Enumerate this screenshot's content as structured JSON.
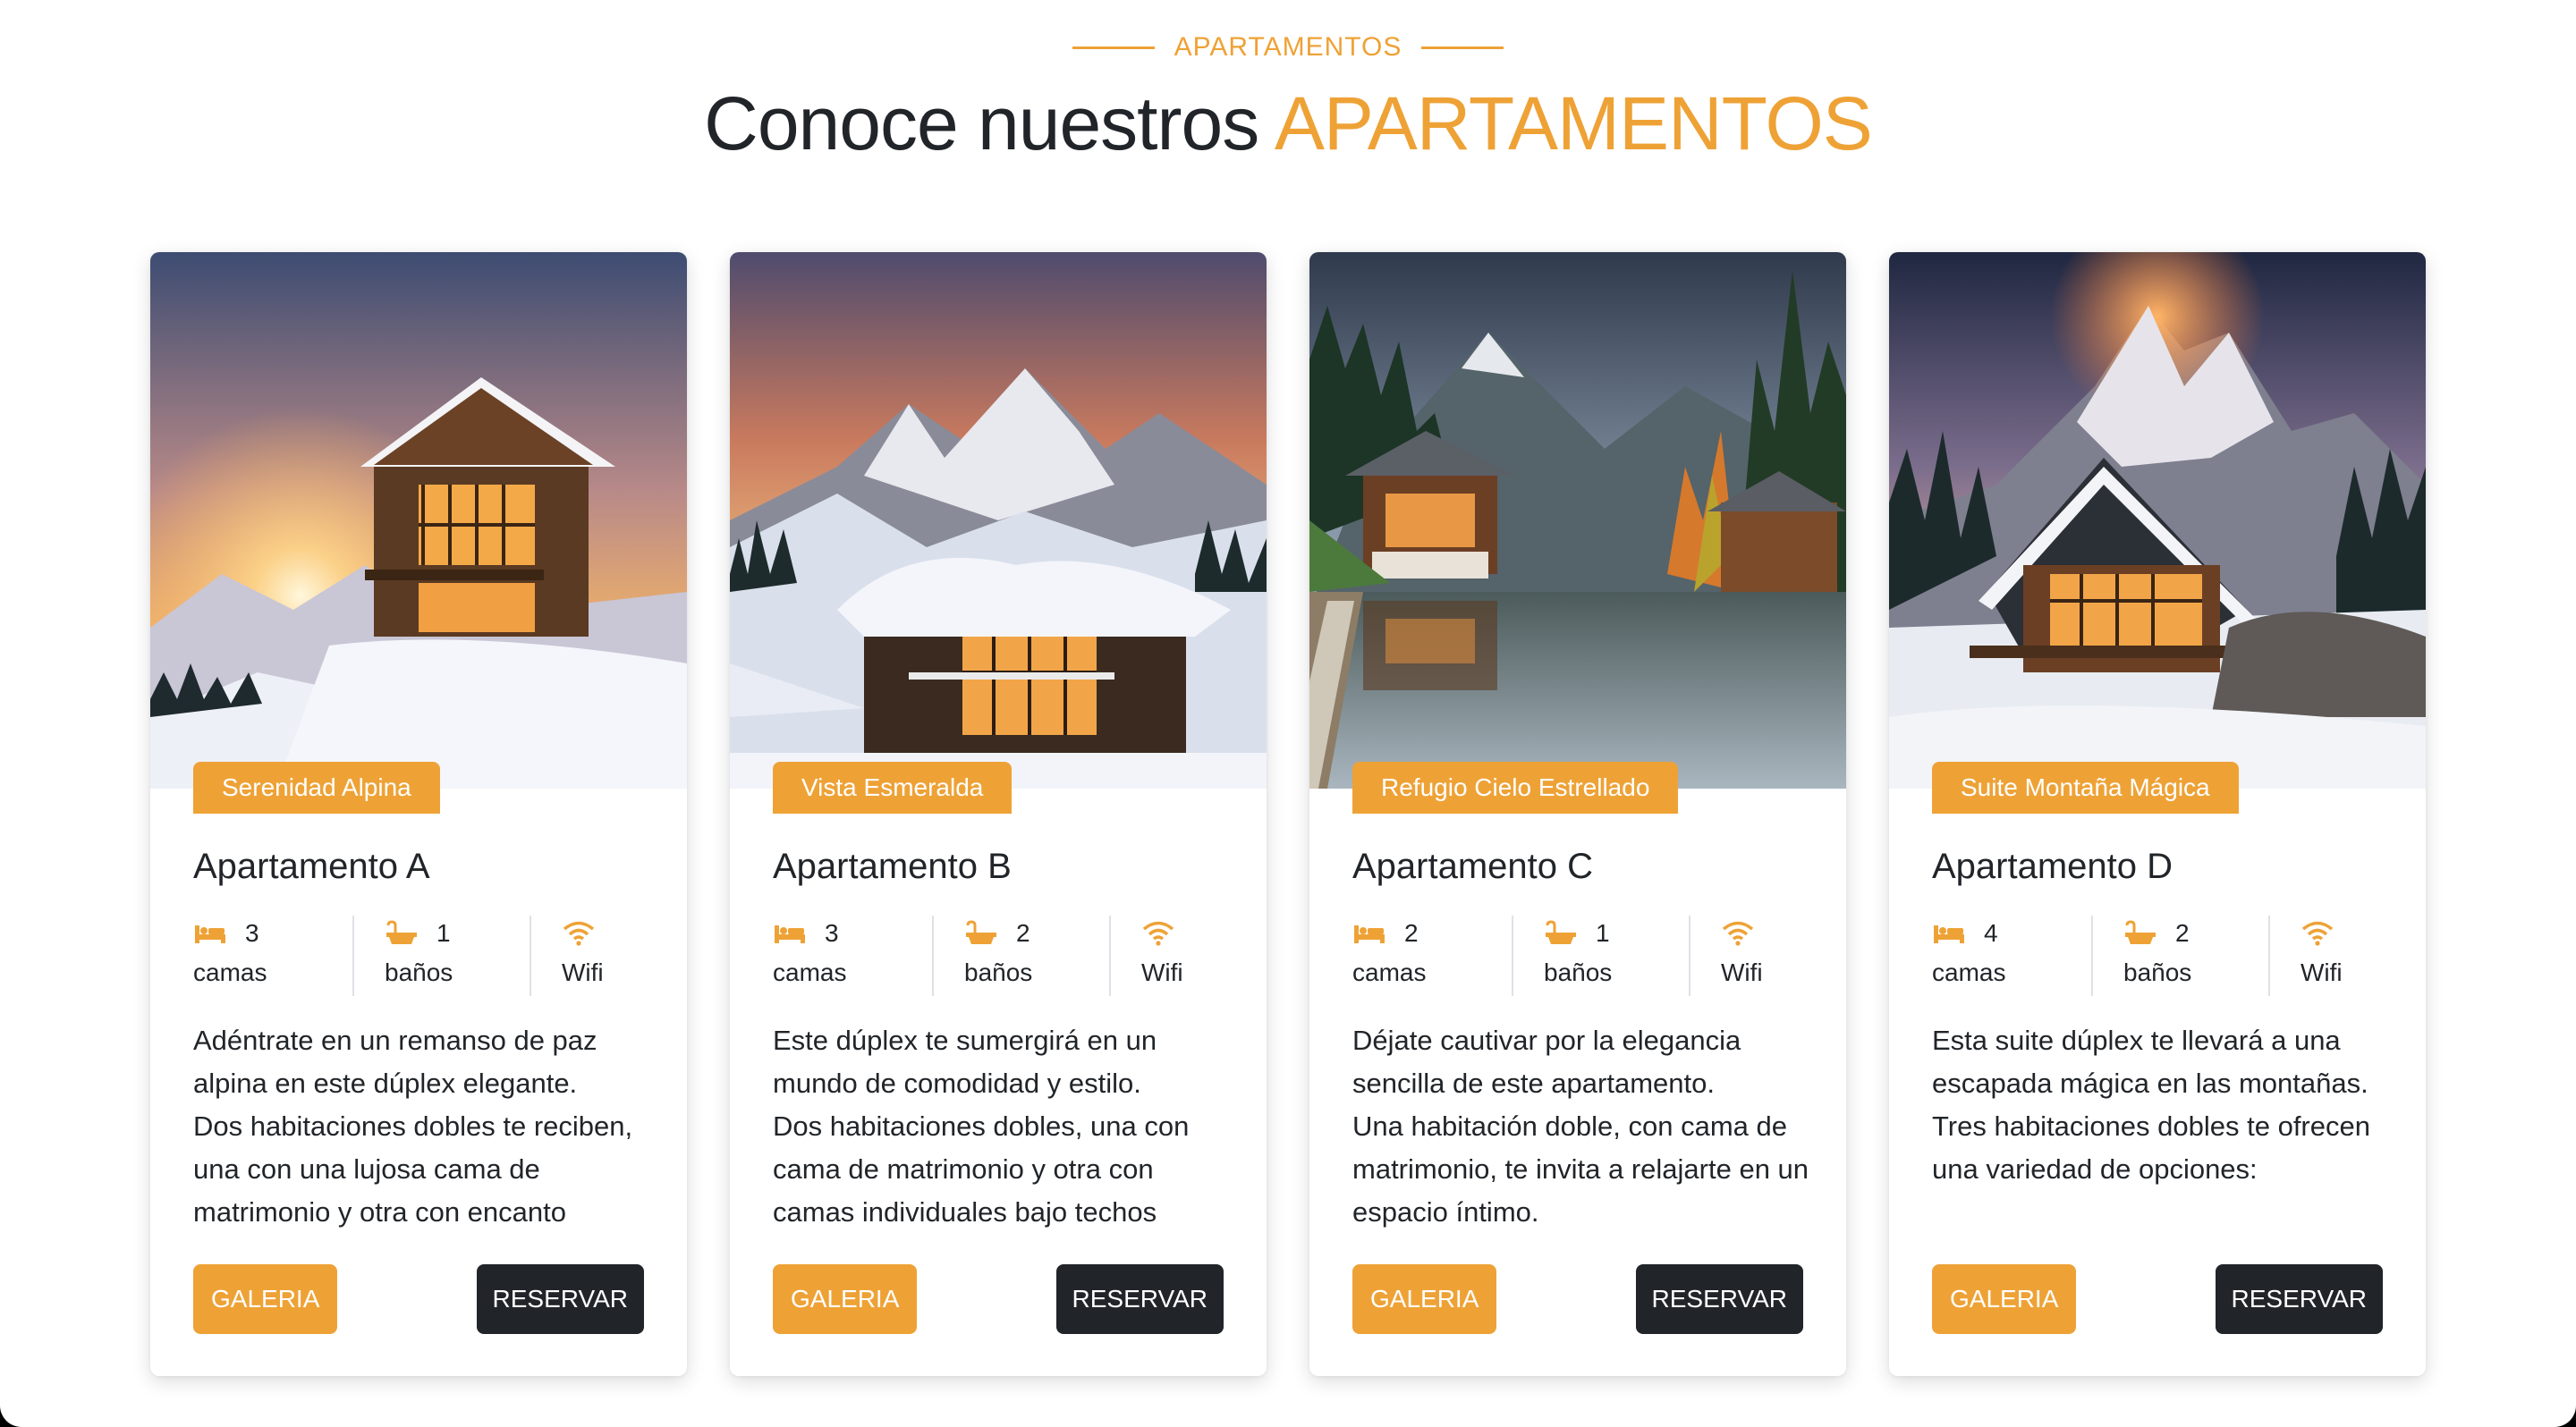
{
  "section": {
    "eyebrow": "APARTAMENTOS",
    "heading_main": "Conoce nuestros ",
    "heading_accent": "APARTAMENTOS"
  },
  "colors": {
    "accent": "#eea236",
    "dark": "#212529",
    "divider": "#dee2e6"
  },
  "icons": {
    "beds": "bed-icon",
    "baths": "bathtub-icon",
    "wifi": "wifi-icon"
  },
  "cards": [
    {
      "badge": "Serenidad Alpina",
      "title": "Apartamento A",
      "beds_count": "3",
      "beds_label": "camas",
      "baths_count": "1",
      "baths_label": "baños",
      "wifi_label": "Wifi",
      "description": [
        "Adéntrate en un remanso de paz alpina en este dúplex elegante.",
        "Dos habitaciones dobles te reciben, una con una lujosa cama de matrimonio y otra con encanto"
      ],
      "gallery_label": "GALERIA",
      "reserve_label": "RESERVAR"
    },
    {
      "badge": "Vista Esmeralda",
      "title": "Apartamento B",
      "beds_count": "3",
      "beds_label": "camas",
      "baths_count": "2",
      "baths_label": "baños",
      "wifi_label": "Wifi",
      "description": [
        "Este dúplex te sumergirá en un mundo de comodidad y estilo.",
        "Dos habitaciones dobles, una con cama de matrimonio y otra con camas individuales bajo techos"
      ],
      "gallery_label": "GALERIA",
      "reserve_label": "RESERVAR"
    },
    {
      "badge": "Refugio Cielo Estrellado",
      "title": "Apartamento C",
      "beds_count": "2",
      "beds_label": "camas",
      "baths_count": "1",
      "baths_label": "baños",
      "wifi_label": "Wifi",
      "description": [
        "Déjate cautivar por la elegancia sencilla de este apartamento.",
        "Una habitación doble, con cama de matrimonio, te invita a relajarte en un espacio íntimo."
      ],
      "gallery_label": "GALERIA",
      "reserve_label": "RESERVAR"
    },
    {
      "badge": "Suite Montaña Mágica",
      "title": "Apartamento D",
      "beds_count": "4",
      "beds_label": "camas",
      "baths_count": "2",
      "baths_label": "baños",
      "wifi_label": "Wifi",
      "description": [
        "Esta suite dúplex te llevará a una escapada mágica en las montañas.",
        "Tres habitaciones dobles te ofrecen una variedad de opciones:"
      ],
      "gallery_label": "GALERIA",
      "reserve_label": "RESERVAR"
    }
  ]
}
